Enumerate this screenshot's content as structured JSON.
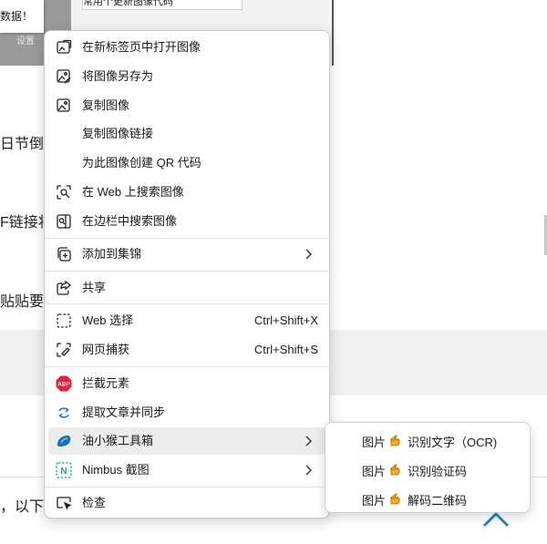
{
  "background": {
    "toast_text": "数据！",
    "thumb_label": "设置",
    "top_chip_text": "常用个更新图像代码",
    "snippets": [
      "日节倒计",
      "F链接将",
      "贴贴要说",
      "，以下"
    ],
    "colors": {
      "accent": "#1e88c8"
    }
  },
  "menu": {
    "items": [
      {
        "icon": "open-new-tab-icon",
        "label": "在新标签页中打开图像"
      },
      {
        "icon": "save-image-icon",
        "label": "将图像另存为"
      },
      {
        "icon": "copy-image-icon",
        "label": "复制图像"
      },
      {
        "icon": "",
        "label": "复制图像链接"
      },
      {
        "icon": "",
        "label": "为此图像创建 QR 代码"
      },
      {
        "icon": "visual-search-icon",
        "label": "在 Web 上搜索图像"
      },
      {
        "icon": "sidebar-search-icon",
        "label": "在边栏中搜索图像"
      },
      {
        "icon": "collections-add-icon",
        "label": "添加到集锦"
      },
      {
        "icon": "share-icon",
        "label": "共享"
      },
      {
        "icon": "web-select-icon",
        "label": "Web 选择",
        "shortcut": "Ctrl+Shift+X"
      },
      {
        "icon": "web-capture-icon",
        "label": "网页捕获",
        "shortcut": "Ctrl+Shift+S"
      },
      {
        "icon": "adblock-icon",
        "label": "拦截元素",
        "badge": "ABP"
      },
      {
        "icon": "sync-icon",
        "label": "提取文章并同步"
      },
      {
        "icon": "youhou-toolbox-icon",
        "label": "油小猴工具箱"
      },
      {
        "icon": "nimbus-icon",
        "label": "Nimbus 截图",
        "badge": "N"
      },
      {
        "icon": "inspect-icon",
        "label": "检查"
      }
    ]
  },
  "submenu": {
    "items": [
      {
        "prefix": "图片",
        "label": "识别文字（OCR)"
      },
      {
        "prefix": "图片",
        "label": "识别验证码"
      },
      {
        "prefix": "图片",
        "label": "解码二维码"
      }
    ]
  }
}
